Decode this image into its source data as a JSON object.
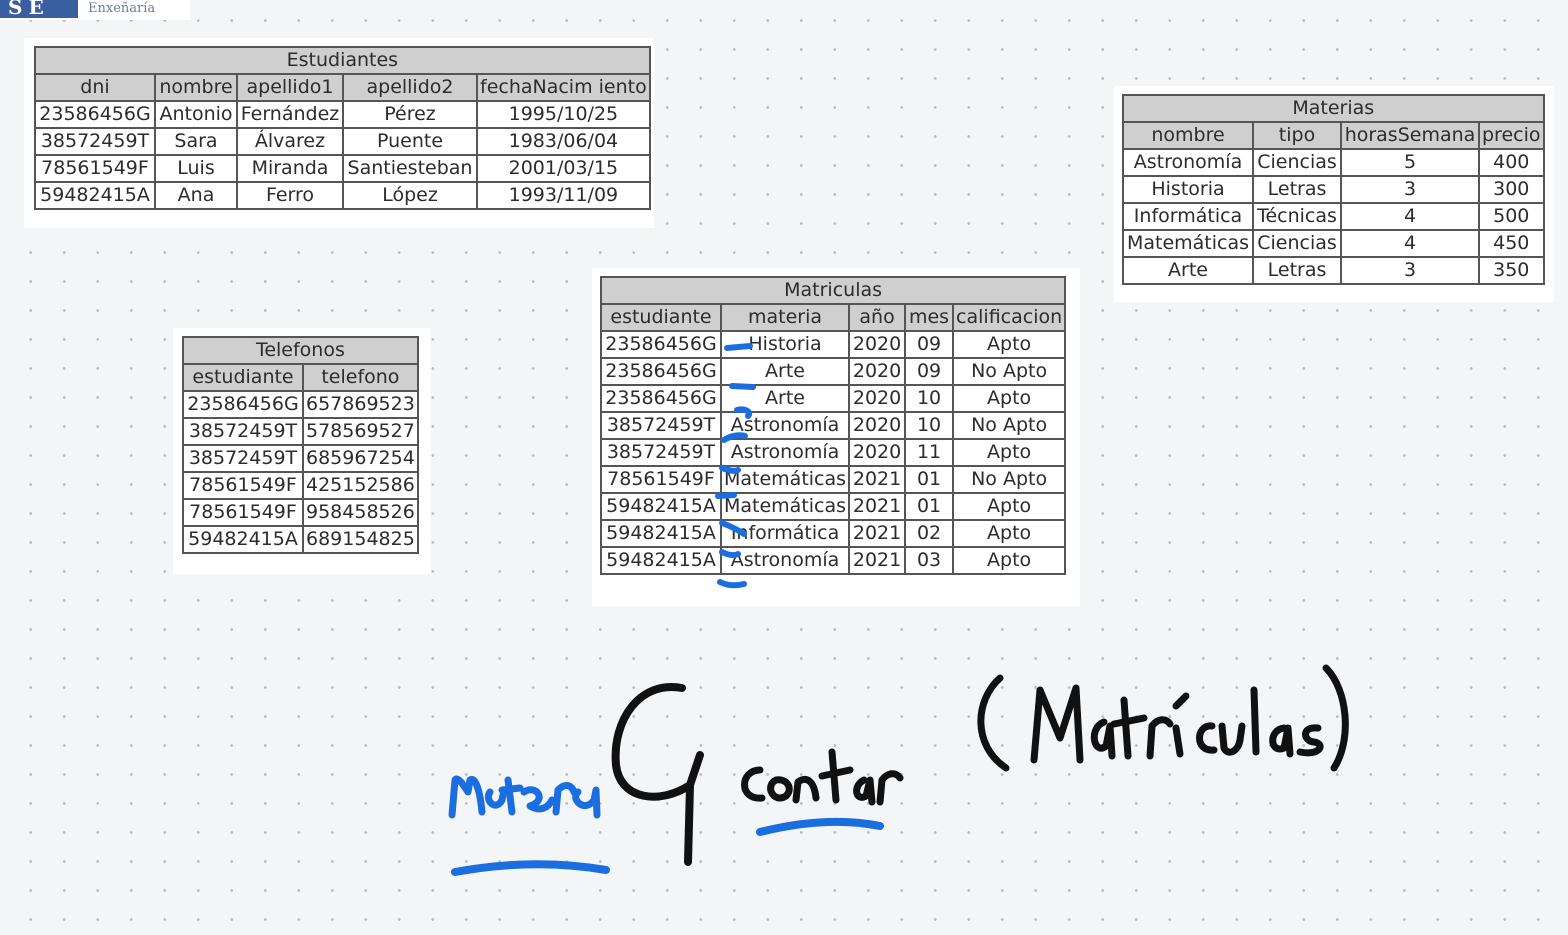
{
  "logo": {
    "mark": "SE",
    "subtitle": "Enxeñaría"
  },
  "estudiantes": {
    "title": "Estudiantes",
    "columns": [
      "dni",
      "nombre",
      "apellido1",
      "apellido2",
      "fechaNacim iento"
    ],
    "rows": [
      [
        "23586456G",
        "Antonio",
        "Fernández",
        "Pérez",
        "1995/10/25"
      ],
      [
        "38572459T",
        "Sara",
        "Álvarez",
        "Puente",
        "1983/06/04"
      ],
      [
        "78561549F",
        "Luis",
        "Miranda",
        "Santiesteban",
        "2001/03/15"
      ],
      [
        "59482415A",
        "Ana",
        "Ferro",
        "López",
        "1993/11/09"
      ]
    ]
  },
  "materias": {
    "title": "Materias",
    "columns": [
      "nombre",
      "tipo",
      "horasSemana",
      "precio"
    ],
    "rows": [
      [
        "Astronomía",
        "Ciencias",
        "5",
        "400"
      ],
      [
        "Historia",
        "Letras",
        "3",
        "300"
      ],
      [
        "Informática",
        "Técnicas",
        "4",
        "500"
      ],
      [
        "Matemáticas",
        "Ciencias",
        "4",
        "450"
      ],
      [
        "Arte",
        "Letras",
        "3",
        "350"
      ]
    ]
  },
  "telefonos": {
    "title": "Telefonos",
    "columns": [
      "estudiante",
      "telefono"
    ],
    "rows": [
      [
        "23586456G",
        "657869523"
      ],
      [
        "38572459T",
        "578569527"
      ],
      [
        "38572459T",
        "685967254"
      ],
      [
        "78561549F",
        "425152586"
      ],
      [
        "78561549F",
        "958458526"
      ],
      [
        "59482415A",
        "689154825"
      ]
    ]
  },
  "matriculas": {
    "title": "Matriculas",
    "columns": [
      "estudiante",
      "materia",
      "año",
      "mes",
      "calificacion"
    ],
    "rows": [
      [
        "23586456G",
        "Historia",
        "2020",
        "09",
        "Apto"
      ],
      [
        "23586456G",
        "Arte",
        "2020",
        "09",
        "No Apto"
      ],
      [
        "23586456G",
        "Arte",
        "2020",
        "10",
        "Apto"
      ],
      [
        "38572459T",
        "Astronomía",
        "2020",
        "10",
        "No Apto"
      ],
      [
        "38572459T",
        "Astronomía",
        "2020",
        "11",
        "Apto"
      ],
      [
        "78561549F",
        "Matemáticas",
        "2021",
        "01",
        "No Apto"
      ],
      [
        "59482415A",
        "Matemáticas",
        "2021",
        "01",
        "Apto"
      ],
      [
        "59482415A",
        "Informática",
        "2021",
        "02",
        "Apto"
      ],
      [
        "59482415A",
        "Astronomía",
        "2021",
        "03",
        "Apto"
      ]
    ]
  },
  "annotations": {
    "ink_colors": {
      "blue": "#1a6ee0",
      "black": "#111111"
    },
    "handwritten": [
      "materia",
      "G",
      "contar",
      "(Matrículas)"
    ]
  }
}
